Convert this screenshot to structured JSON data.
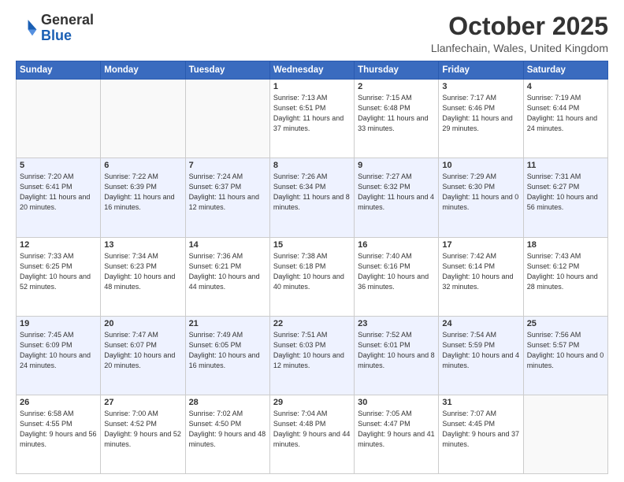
{
  "logo": {
    "general": "General",
    "blue": "Blue"
  },
  "header": {
    "month": "October 2025",
    "location": "Llanfechain, Wales, United Kingdom"
  },
  "weekdays": [
    "Sunday",
    "Monday",
    "Tuesday",
    "Wednesday",
    "Thursday",
    "Friday",
    "Saturday"
  ],
  "weeks": [
    [
      {
        "day": "",
        "sunrise": "",
        "sunset": "",
        "daylight": ""
      },
      {
        "day": "",
        "sunrise": "",
        "sunset": "",
        "daylight": ""
      },
      {
        "day": "",
        "sunrise": "",
        "sunset": "",
        "daylight": ""
      },
      {
        "day": "1",
        "sunrise": "Sunrise: 7:13 AM",
        "sunset": "Sunset: 6:51 PM",
        "daylight": "Daylight: 11 hours and 37 minutes."
      },
      {
        "day": "2",
        "sunrise": "Sunrise: 7:15 AM",
        "sunset": "Sunset: 6:48 PM",
        "daylight": "Daylight: 11 hours and 33 minutes."
      },
      {
        "day": "3",
        "sunrise": "Sunrise: 7:17 AM",
        "sunset": "Sunset: 6:46 PM",
        "daylight": "Daylight: 11 hours and 29 minutes."
      },
      {
        "day": "4",
        "sunrise": "Sunrise: 7:19 AM",
        "sunset": "Sunset: 6:44 PM",
        "daylight": "Daylight: 11 hours and 24 minutes."
      }
    ],
    [
      {
        "day": "5",
        "sunrise": "Sunrise: 7:20 AM",
        "sunset": "Sunset: 6:41 PM",
        "daylight": "Daylight: 11 hours and 20 minutes."
      },
      {
        "day": "6",
        "sunrise": "Sunrise: 7:22 AM",
        "sunset": "Sunset: 6:39 PM",
        "daylight": "Daylight: 11 hours and 16 minutes."
      },
      {
        "day": "7",
        "sunrise": "Sunrise: 7:24 AM",
        "sunset": "Sunset: 6:37 PM",
        "daylight": "Daylight: 11 hours and 12 minutes."
      },
      {
        "day": "8",
        "sunrise": "Sunrise: 7:26 AM",
        "sunset": "Sunset: 6:34 PM",
        "daylight": "Daylight: 11 hours and 8 minutes."
      },
      {
        "day": "9",
        "sunrise": "Sunrise: 7:27 AM",
        "sunset": "Sunset: 6:32 PM",
        "daylight": "Daylight: 11 hours and 4 minutes."
      },
      {
        "day": "10",
        "sunrise": "Sunrise: 7:29 AM",
        "sunset": "Sunset: 6:30 PM",
        "daylight": "Daylight: 11 hours and 0 minutes."
      },
      {
        "day": "11",
        "sunrise": "Sunrise: 7:31 AM",
        "sunset": "Sunset: 6:27 PM",
        "daylight": "Daylight: 10 hours and 56 minutes."
      }
    ],
    [
      {
        "day": "12",
        "sunrise": "Sunrise: 7:33 AM",
        "sunset": "Sunset: 6:25 PM",
        "daylight": "Daylight: 10 hours and 52 minutes."
      },
      {
        "day": "13",
        "sunrise": "Sunrise: 7:34 AM",
        "sunset": "Sunset: 6:23 PM",
        "daylight": "Daylight: 10 hours and 48 minutes."
      },
      {
        "day": "14",
        "sunrise": "Sunrise: 7:36 AM",
        "sunset": "Sunset: 6:21 PM",
        "daylight": "Daylight: 10 hours and 44 minutes."
      },
      {
        "day": "15",
        "sunrise": "Sunrise: 7:38 AM",
        "sunset": "Sunset: 6:18 PM",
        "daylight": "Daylight: 10 hours and 40 minutes."
      },
      {
        "day": "16",
        "sunrise": "Sunrise: 7:40 AM",
        "sunset": "Sunset: 6:16 PM",
        "daylight": "Daylight: 10 hours and 36 minutes."
      },
      {
        "day": "17",
        "sunrise": "Sunrise: 7:42 AM",
        "sunset": "Sunset: 6:14 PM",
        "daylight": "Daylight: 10 hours and 32 minutes."
      },
      {
        "day": "18",
        "sunrise": "Sunrise: 7:43 AM",
        "sunset": "Sunset: 6:12 PM",
        "daylight": "Daylight: 10 hours and 28 minutes."
      }
    ],
    [
      {
        "day": "19",
        "sunrise": "Sunrise: 7:45 AM",
        "sunset": "Sunset: 6:09 PM",
        "daylight": "Daylight: 10 hours and 24 minutes."
      },
      {
        "day": "20",
        "sunrise": "Sunrise: 7:47 AM",
        "sunset": "Sunset: 6:07 PM",
        "daylight": "Daylight: 10 hours and 20 minutes."
      },
      {
        "day": "21",
        "sunrise": "Sunrise: 7:49 AM",
        "sunset": "Sunset: 6:05 PM",
        "daylight": "Daylight: 10 hours and 16 minutes."
      },
      {
        "day": "22",
        "sunrise": "Sunrise: 7:51 AM",
        "sunset": "Sunset: 6:03 PM",
        "daylight": "Daylight: 10 hours and 12 minutes."
      },
      {
        "day": "23",
        "sunrise": "Sunrise: 7:52 AM",
        "sunset": "Sunset: 6:01 PM",
        "daylight": "Daylight: 10 hours and 8 minutes."
      },
      {
        "day": "24",
        "sunrise": "Sunrise: 7:54 AM",
        "sunset": "Sunset: 5:59 PM",
        "daylight": "Daylight: 10 hours and 4 minutes."
      },
      {
        "day": "25",
        "sunrise": "Sunrise: 7:56 AM",
        "sunset": "Sunset: 5:57 PM",
        "daylight": "Daylight: 10 hours and 0 minutes."
      }
    ],
    [
      {
        "day": "26",
        "sunrise": "Sunrise: 6:58 AM",
        "sunset": "Sunset: 4:55 PM",
        "daylight": "Daylight: 9 hours and 56 minutes."
      },
      {
        "day": "27",
        "sunrise": "Sunrise: 7:00 AM",
        "sunset": "Sunset: 4:52 PM",
        "daylight": "Daylight: 9 hours and 52 minutes."
      },
      {
        "day": "28",
        "sunrise": "Sunrise: 7:02 AM",
        "sunset": "Sunset: 4:50 PM",
        "daylight": "Daylight: 9 hours and 48 minutes."
      },
      {
        "day": "29",
        "sunrise": "Sunrise: 7:04 AM",
        "sunset": "Sunset: 4:48 PM",
        "daylight": "Daylight: 9 hours and 44 minutes."
      },
      {
        "day": "30",
        "sunrise": "Sunrise: 7:05 AM",
        "sunset": "Sunset: 4:47 PM",
        "daylight": "Daylight: 9 hours and 41 minutes."
      },
      {
        "day": "31",
        "sunrise": "Sunrise: 7:07 AM",
        "sunset": "Sunset: 4:45 PM",
        "daylight": "Daylight: 9 hours and 37 minutes."
      },
      {
        "day": "",
        "sunrise": "",
        "sunset": "",
        "daylight": ""
      }
    ]
  ]
}
